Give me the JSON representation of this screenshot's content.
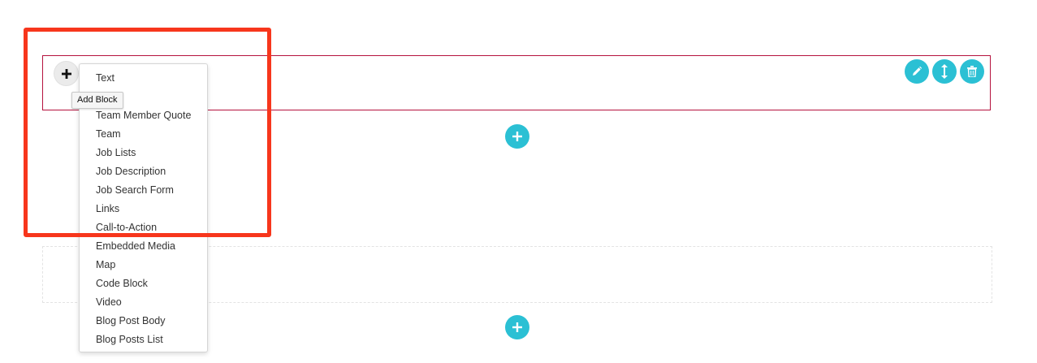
{
  "add_block": {
    "button_icon": "plus-icon",
    "tooltip": "Add Block"
  },
  "block_menu": {
    "items": [
      "Text",
      "",
      "Team Member Quote",
      "Team",
      "Job Lists",
      "Job Description",
      "Job Search Form",
      "Links",
      "Call-to-Action",
      "Embedded Media",
      "Map",
      "Code Block",
      "Video",
      "Blog Post Body",
      "Blog Posts List"
    ]
  },
  "section_controls": {
    "icons": [
      "pencil-icon",
      "resize-vertical-icon",
      "trash-icon"
    ]
  },
  "add_section": {
    "icon": "plus-icon"
  },
  "colors": {
    "accent": "#2bc0d4",
    "section_border": "#b5123e",
    "highlight": "#f7361c"
  }
}
